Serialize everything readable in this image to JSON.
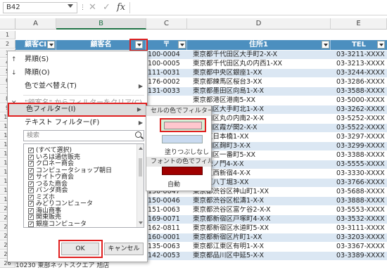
{
  "formula_bar": {
    "name_box": "B42",
    "fx_label": "fx",
    "cancel_glyph": "✕",
    "enter_glyph": "✓",
    "formula": ""
  },
  "columns": [
    "A",
    "B",
    "C",
    "D",
    "E"
  ],
  "row_numbers": [
    "1",
    "2",
    "3",
    "4",
    "5",
    "6",
    "7",
    "8",
    "9",
    "10",
    "11",
    "12",
    "13",
    "14",
    "15",
    "16",
    "17",
    "18",
    "19",
    "20",
    "21",
    "22",
    "23",
    "24",
    "25",
    "26"
  ],
  "table_header": {
    "customer_code": "顧客CI",
    "customer_name": "顧客名",
    "zip": "〒",
    "address": "住所1",
    "tel": "TEL"
  },
  "rows": [
    {
      "zip": "100-0004",
      "addr": "東京都千代田区大手町2-X-X",
      "tel": "03-3211-XXXX"
    },
    {
      "zip": "100-0005",
      "addr": "東京都千代田区丸の内西1-XX",
      "tel": "03-3213-XXXX"
    },
    {
      "zip": "111-0031",
      "addr": "東京都中央区銀座1-XX",
      "tel": "03-3244-XXXX"
    },
    {
      "zip": "176-0002",
      "addr": "東京都練馬区桜台3-XX",
      "tel": "03-3286-XXXX"
    },
    {
      "zip": "131-0033",
      "addr": "東京都墨田区向島1-X-X",
      "tel": "03-3588-XXXX"
    },
    {
      "zip": "",
      "addr": "東京都港区港南5-XX",
      "tel": "03-5000-XXXX"
    },
    {
      "zip": "",
      "addr": "千代田区大手町北1-X-X",
      "tel": "03-3262-XXXX"
    },
    {
      "zip": "",
      "addr": "千代田区丸の内南2-X-X",
      "tel": "03-5252-XXXX"
    },
    {
      "zip": "",
      "addr": "千代田区霞が関2-X-X",
      "tel": "03-5522-XXXX"
    },
    {
      "zip": "",
      "addr": "中央区日本橋1-XX",
      "tel": "03-3297-XXXX"
    },
    {
      "zip": "",
      "addr": "千代田区麹町3-X-X",
      "tel": "03-3299-XXXX"
    },
    {
      "zip": "",
      "addr": "千代田区一番町5-XX",
      "tel": "03-3388-XXXX"
    },
    {
      "zip": "",
      "addr": "港区虎ノ門4-X-X",
      "tel": "03-5555-XXXX"
    },
    {
      "zip": "",
      "addr": "新宿区西新宿4-X-X",
      "tel": "03-3330-XXXX"
    },
    {
      "zip": "",
      "addr": "中央区八丁堀3-XX",
      "tel": "03-3766-XXXX"
    },
    {
      "zip": "150-0047",
      "addr": "東京都渋谷区神山町1-XX",
      "tel": "03-5688-XXXX"
    },
    {
      "zip": "150-0046",
      "addr": "東京都渋谷区松濤1-X-X",
      "tel": "03-3888-XXXX"
    },
    {
      "zip": "151-0063",
      "addr": "東京都渋谷区富ケ谷2-X-X",
      "tel": "03-5553-XXXX"
    },
    {
      "zip": "169-0071",
      "addr": "東京都新宿区戸塚町4-X-X",
      "tel": "03-3532-XXXX"
    },
    {
      "zip": "162-0811",
      "addr": "東京都新宿区水道町5-XX",
      "tel": "03-3111-XXXX"
    },
    {
      "zip": "160-0001",
      "addr": "東京都新宿区片町1-XX",
      "tel": "03-3203-XXXX"
    },
    {
      "zip": "135-0063",
      "addr": "東京都江東区有明1-X-X",
      "tel": "03-3367-XXXX"
    },
    {
      "zip": "142-0053",
      "addr": "東京都品川区中延5-X-X",
      "tel": "03-3389-XXXX"
    }
  ],
  "bottom_row_text": "10230 東部ネットスクエア 旭店",
  "filter_menu": {
    "items": [
      {
        "label": "昇順(S)",
        "icon": "↑",
        "disabled": false
      },
      {
        "label": "降順(O)",
        "icon": "↓",
        "disabled": false
      },
      {
        "label": "色で並べ替え(T)",
        "icon": "",
        "disabled": false,
        "arrow": "▶"
      },
      {
        "label": "\"顧客名\" からフィルターをクリア(C)",
        "icon": "✕",
        "disabled": true
      },
      {
        "label": "色フィルター(I)",
        "icon": "",
        "disabled": false,
        "arrow": "▶",
        "active": true
      },
      {
        "label": "テキスト フィルター(F)",
        "icon": "",
        "disabled": false,
        "arrow": "▶"
      }
    ],
    "search_placeholder": "検索",
    "list": [
      "(すべて選択)",
      "いろは通信販売",
      "クロネー商会",
      "コンピュータショップ朝日",
      "サイトウ商会",
      "つるた商会",
      "パンダ商会",
      "ミズホ",
      "みどりコンピュータ",
      "海山商事",
      "関東販売",
      "銀座コンピュータ"
    ],
    "ok_label": "OK",
    "cancel_label": "キャンセル"
  },
  "color_submenu": {
    "cell_color_header": "セルの色でフィルター",
    "no_fill_label": "塗りつぶしなし",
    "font_color_header": "フォントの色でフィルター",
    "auto_label": "自動",
    "colors": {
      "pink": "#ffc7ce",
      "blue": "#c9daf0",
      "dark_red": "#a00000"
    }
  },
  "accent_colors": {
    "excel_green": "#217346",
    "header_blue": "#4c8fbf",
    "highlight_red": "#e02020"
  }
}
